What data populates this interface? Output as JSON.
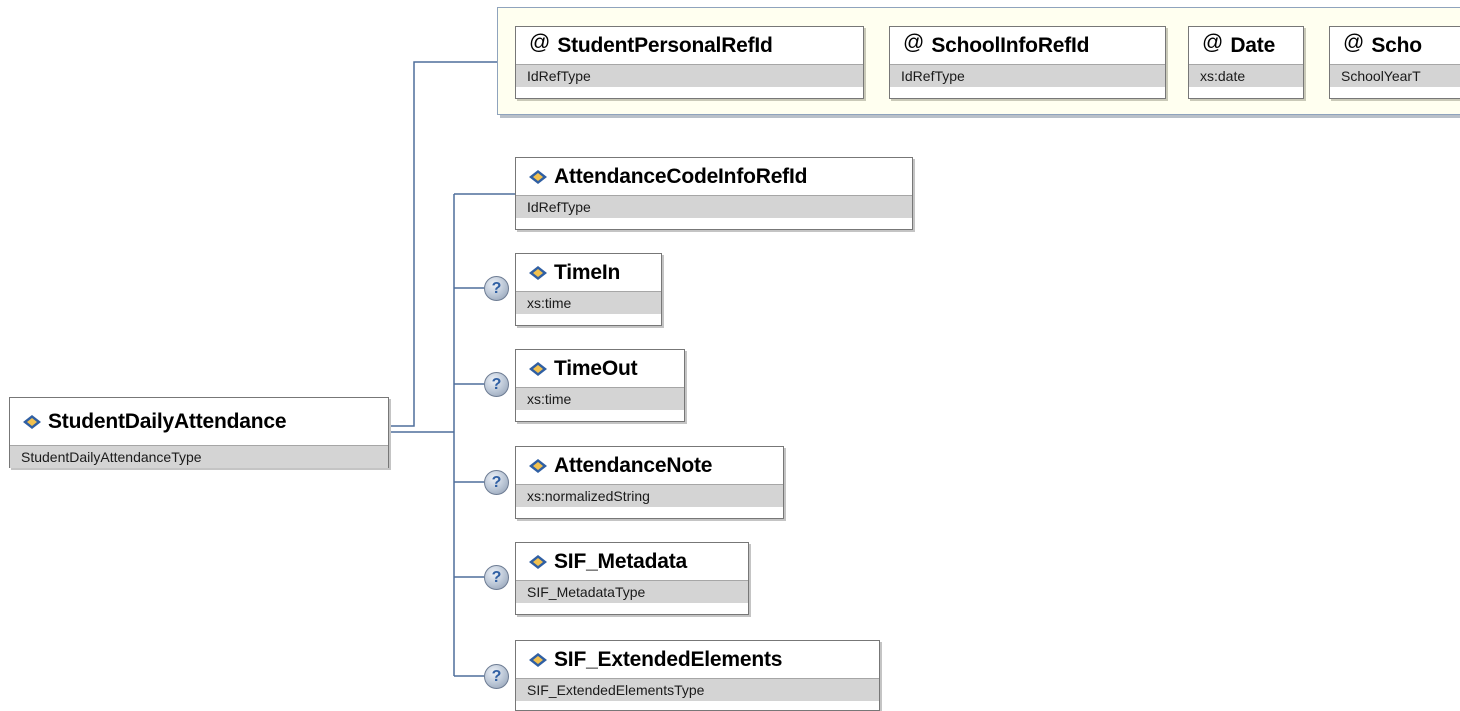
{
  "root": {
    "name": "StudentDailyAttendance",
    "type": "StudentDailyAttendanceType"
  },
  "attributes": [
    {
      "name": "StudentPersonalRefId",
      "type": "IdRefType"
    },
    {
      "name": "SchoolInfoRefId",
      "type": "IdRefType"
    },
    {
      "name": "Date",
      "type": "xs:date"
    },
    {
      "name": "Scho",
      "type": "SchoolYearT"
    }
  ],
  "elements": [
    {
      "name": "AttendanceCodeInfoRefId",
      "type": "IdRefType",
      "optional": false
    },
    {
      "name": "TimeIn",
      "type": "xs:time",
      "optional": true
    },
    {
      "name": "TimeOut",
      "type": "xs:time",
      "optional": true
    },
    {
      "name": "AttendanceNote",
      "type": "xs:normalizedString",
      "optional": true
    },
    {
      "name": "SIF_Metadata",
      "type": "SIF_MetadataType",
      "optional": true
    },
    {
      "name": "SIF_ExtendedElements",
      "type": "SIF_ExtendedElementsType",
      "optional": true
    }
  ],
  "symbols": {
    "attribute_marker": "@",
    "optional_marker": "?"
  },
  "colors": {
    "connector": "#4e6e9c",
    "attribute_panel_bg": "#fffff0",
    "type_band_bg": "#d4d4d4",
    "icon_blue": "#2f5fa3",
    "icon_yellow": "#f2c14e"
  }
}
